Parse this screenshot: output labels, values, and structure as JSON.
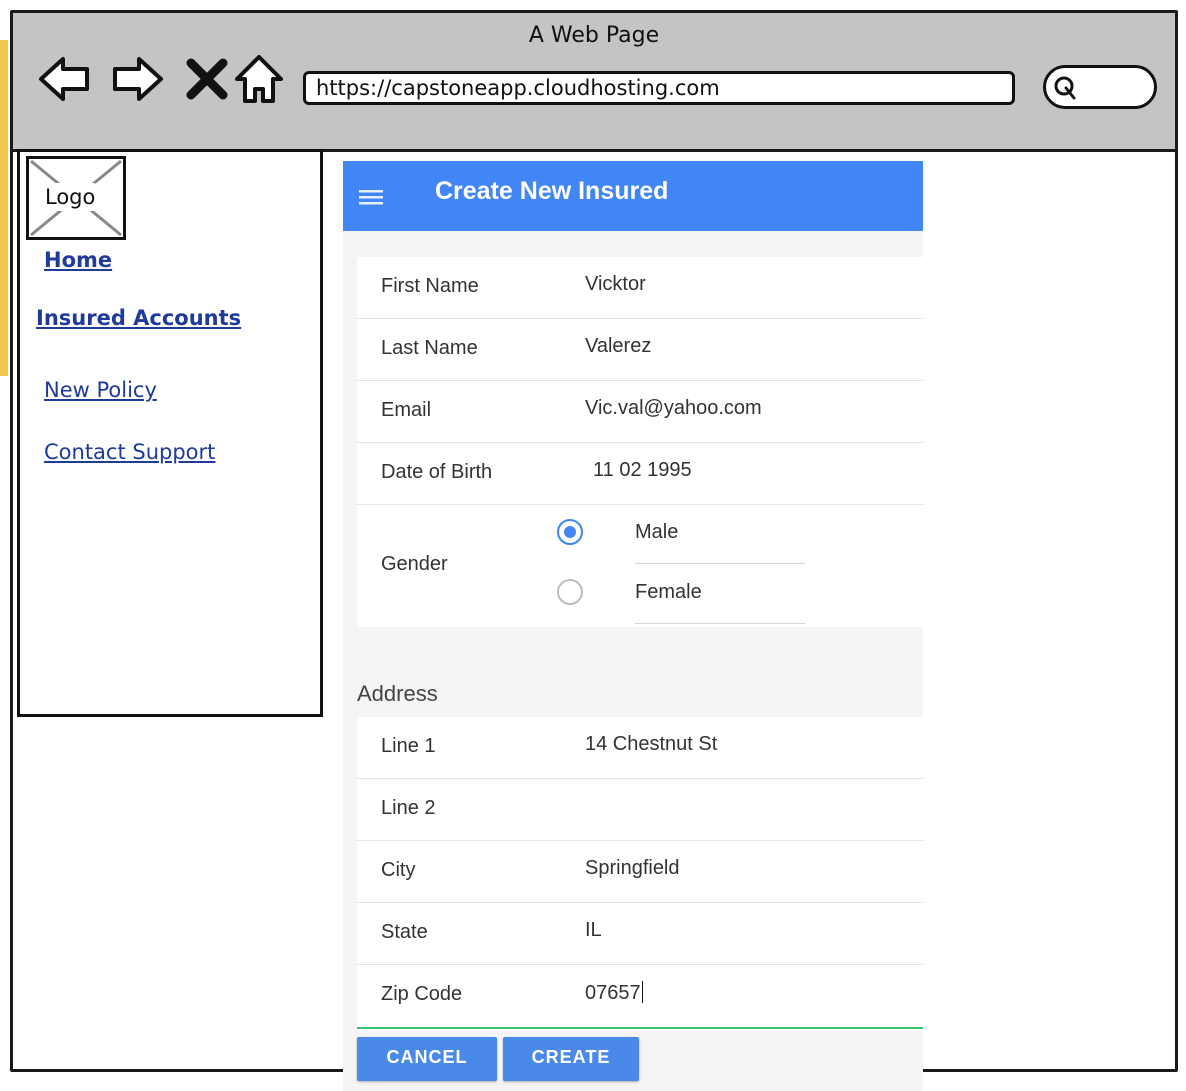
{
  "browser": {
    "page_title": "A Web Page",
    "url": "https://capstoneapp.cloudhosting.com"
  },
  "sidebar": {
    "logo": "Logo",
    "links": [
      "Home",
      "Insured Accounts",
      "New Policy",
      "Contact Support"
    ]
  },
  "form": {
    "title": "Create New Insured",
    "personal": [
      {
        "label": "First Name",
        "value": "Vicktor"
      },
      {
        "label": "Last Name",
        "value": "Valerez"
      },
      {
        "label": "Email",
        "value": "Vic.val@yahoo.com"
      },
      {
        "label": "Date of Birth",
        "value": "11 02 1995"
      }
    ],
    "gender": {
      "label": "Gender",
      "options": [
        "Male",
        "Female"
      ],
      "selected": "Male"
    },
    "address_heading": "Address",
    "address": [
      {
        "label": "Line 1",
        "value": "14 Chestnut St"
      },
      {
        "label": "Line 2",
        "value": ""
      },
      {
        "label": "City",
        "value": "Springfield"
      },
      {
        "label": "State",
        "value": "IL"
      },
      {
        "label": "Zip Code",
        "value": "07657"
      }
    ],
    "buttons": {
      "cancel": "CANCEL",
      "create": "CREATE"
    }
  },
  "colors": {
    "header": "#4285f4",
    "link": "#1f3a9b",
    "browser_chrome": "#c4c4c4",
    "focus_underline": "#34c36a"
  }
}
